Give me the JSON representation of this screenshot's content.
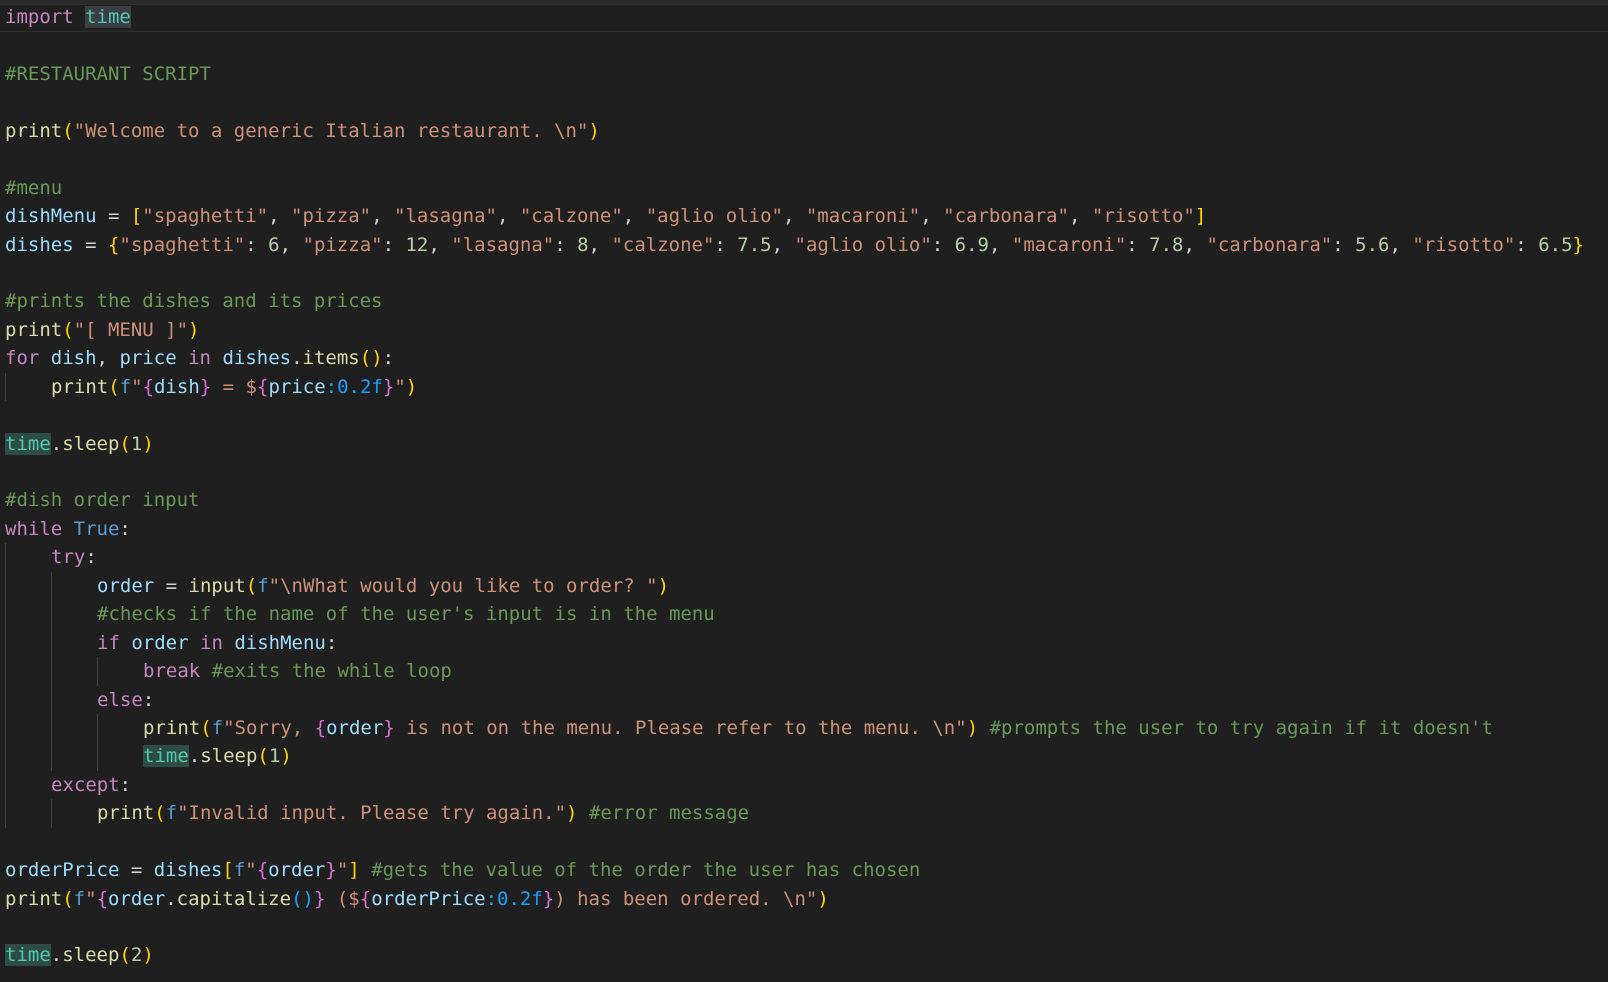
{
  "colors": {
    "background": "#1f1f1f",
    "keyword": "#c586c0",
    "function": "#dcdcaa",
    "variable": "#9cdcfe",
    "string": "#ce9178",
    "comment": "#6a9955",
    "number": "#b5cea8",
    "module": "#4ec9b0",
    "constant": "#569cd6",
    "plain": "#d4d4d4",
    "bracket1": "#ffd700",
    "bracket2": "#da70d6",
    "bracket3": "#179fff"
  },
  "lines": [
    {
      "indent": 0,
      "tokens": [
        {
          "t": "import",
          "k": "keyword"
        },
        {
          "t": " ",
          "k": "plain"
        },
        {
          "t": "time",
          "k": "module",
          "hl": true
        }
      ]
    },
    {
      "indent": 0,
      "tokens": []
    },
    {
      "indent": 0,
      "tokens": [
        {
          "t": "#RESTAURANT SCRIPT",
          "k": "comment"
        }
      ]
    },
    {
      "indent": 0,
      "tokens": []
    },
    {
      "indent": 0,
      "tokens": [
        {
          "t": "print",
          "k": "function"
        },
        {
          "t": "(",
          "k": "bracket1"
        },
        {
          "t": "\"Welcome to a generic Italian restaurant. \\n\"",
          "k": "string"
        },
        {
          "t": ")",
          "k": "bracket1"
        }
      ]
    },
    {
      "indent": 0,
      "tokens": []
    },
    {
      "indent": 0,
      "tokens": [
        {
          "t": "#menu",
          "k": "comment"
        }
      ]
    },
    {
      "indent": 0,
      "tokens": [
        {
          "t": "dishMenu",
          "k": "variable"
        },
        {
          "t": " = ",
          "k": "plain"
        },
        {
          "t": "[",
          "k": "bracket1"
        },
        {
          "t": "\"spaghetti\"",
          "k": "string"
        },
        {
          "t": ", ",
          "k": "plain"
        },
        {
          "t": "\"pizza\"",
          "k": "string"
        },
        {
          "t": ", ",
          "k": "plain"
        },
        {
          "t": "\"lasagna\"",
          "k": "string"
        },
        {
          "t": ", ",
          "k": "plain"
        },
        {
          "t": "\"calzone\"",
          "k": "string"
        },
        {
          "t": ", ",
          "k": "plain"
        },
        {
          "t": "\"aglio olio\"",
          "k": "string"
        },
        {
          "t": ", ",
          "k": "plain"
        },
        {
          "t": "\"macaroni\"",
          "k": "string"
        },
        {
          "t": ", ",
          "k": "plain"
        },
        {
          "t": "\"carbonara\"",
          "k": "string"
        },
        {
          "t": ", ",
          "k": "plain"
        },
        {
          "t": "\"risotto\"",
          "k": "string"
        },
        {
          "t": "]",
          "k": "bracket1"
        }
      ]
    },
    {
      "indent": 0,
      "tokens": [
        {
          "t": "dishes",
          "k": "variable"
        },
        {
          "t": " = ",
          "k": "plain"
        },
        {
          "t": "{",
          "k": "bracket1"
        },
        {
          "t": "\"spaghetti\"",
          "k": "string"
        },
        {
          "t": ": ",
          "k": "plain"
        },
        {
          "t": "6",
          "k": "number"
        },
        {
          "t": ", ",
          "k": "plain"
        },
        {
          "t": "\"pizza\"",
          "k": "string"
        },
        {
          "t": ": ",
          "k": "plain"
        },
        {
          "t": "12",
          "k": "number"
        },
        {
          "t": ", ",
          "k": "plain"
        },
        {
          "t": "\"lasagna\"",
          "k": "string"
        },
        {
          "t": ": ",
          "k": "plain"
        },
        {
          "t": "8",
          "k": "number"
        },
        {
          "t": ", ",
          "k": "plain"
        },
        {
          "t": "\"calzone\"",
          "k": "string"
        },
        {
          "t": ": ",
          "k": "plain"
        },
        {
          "t": "7.5",
          "k": "number"
        },
        {
          "t": ", ",
          "k": "plain"
        },
        {
          "t": "\"aglio olio\"",
          "k": "string"
        },
        {
          "t": ": ",
          "k": "plain"
        },
        {
          "t": "6.9",
          "k": "number"
        },
        {
          "t": ", ",
          "k": "plain"
        },
        {
          "t": "\"macaroni\"",
          "k": "string"
        },
        {
          "t": ": ",
          "k": "plain"
        },
        {
          "t": "7.8",
          "k": "number"
        },
        {
          "t": ", ",
          "k": "plain"
        },
        {
          "t": "\"carbonara\"",
          "k": "string"
        },
        {
          "t": ": ",
          "k": "plain"
        },
        {
          "t": "5.6",
          "k": "number"
        },
        {
          "t": ", ",
          "k": "plain"
        },
        {
          "t": "\"risotto\"",
          "k": "string"
        },
        {
          "t": ": ",
          "k": "plain"
        },
        {
          "t": "6.5",
          "k": "number"
        },
        {
          "t": "}",
          "k": "bracket1"
        }
      ]
    },
    {
      "indent": 0,
      "tokens": []
    },
    {
      "indent": 0,
      "tokens": [
        {
          "t": "#prints the dishes and its prices",
          "k": "comment"
        }
      ]
    },
    {
      "indent": 0,
      "tokens": [
        {
          "t": "print",
          "k": "function"
        },
        {
          "t": "(",
          "k": "bracket1"
        },
        {
          "t": "\"[ MENU ]\"",
          "k": "string"
        },
        {
          "t": ")",
          "k": "bracket1"
        }
      ]
    },
    {
      "indent": 0,
      "tokens": [
        {
          "t": "for",
          "k": "keyword"
        },
        {
          "t": " ",
          "k": "plain"
        },
        {
          "t": "dish",
          "k": "variable"
        },
        {
          "t": ", ",
          "k": "plain"
        },
        {
          "t": "price",
          "k": "variable"
        },
        {
          "t": " ",
          "k": "plain"
        },
        {
          "t": "in",
          "k": "keyword"
        },
        {
          "t": " ",
          "k": "plain"
        },
        {
          "t": "dishes",
          "k": "variable"
        },
        {
          "t": ".",
          "k": "plain"
        },
        {
          "t": "items",
          "k": "function"
        },
        {
          "t": "(",
          "k": "bracket1"
        },
        {
          "t": ")",
          "k": "bracket1"
        },
        {
          "t": ":",
          "k": "plain"
        }
      ]
    },
    {
      "indent": 1,
      "tokens": [
        {
          "t": "print",
          "k": "function"
        },
        {
          "t": "(",
          "k": "bracket1"
        },
        {
          "t": "f",
          "k": "constant"
        },
        {
          "t": "\"",
          "k": "string"
        },
        {
          "t": "{",
          "k": "bracket2"
        },
        {
          "t": "dish",
          "k": "variable"
        },
        {
          "t": "}",
          "k": "bracket2"
        },
        {
          "t": " = $",
          "k": "string"
        },
        {
          "t": "{",
          "k": "bracket2"
        },
        {
          "t": "price",
          "k": "variable"
        },
        {
          "t": ":0.2f",
          "k": "bracket3"
        },
        {
          "t": "}",
          "k": "bracket2"
        },
        {
          "t": "\"",
          "k": "string"
        },
        {
          "t": ")",
          "k": "bracket1"
        }
      ]
    },
    {
      "indent": 0,
      "tokens": []
    },
    {
      "indent": 0,
      "tokens": [
        {
          "t": "time",
          "k": "module",
          "hl2": true
        },
        {
          "t": ".",
          "k": "plain"
        },
        {
          "t": "sleep",
          "k": "function"
        },
        {
          "t": "(",
          "k": "bracket1"
        },
        {
          "t": "1",
          "k": "number"
        },
        {
          "t": ")",
          "k": "bracket1"
        }
      ]
    },
    {
      "indent": 0,
      "tokens": []
    },
    {
      "indent": 0,
      "tokens": [
        {
          "t": "#dish order input",
          "k": "comment"
        }
      ]
    },
    {
      "indent": 0,
      "tokens": [
        {
          "t": "while",
          "k": "keyword"
        },
        {
          "t": " ",
          "k": "plain"
        },
        {
          "t": "True",
          "k": "constant"
        },
        {
          "t": ":",
          "k": "plain"
        }
      ]
    },
    {
      "indent": 1,
      "tokens": [
        {
          "t": "try",
          "k": "keyword"
        },
        {
          "t": ":",
          "k": "plain"
        }
      ]
    },
    {
      "indent": 2,
      "tokens": [
        {
          "t": "order",
          "k": "variable"
        },
        {
          "t": " = ",
          "k": "plain"
        },
        {
          "t": "input",
          "k": "function"
        },
        {
          "t": "(",
          "k": "bracket1"
        },
        {
          "t": "f",
          "k": "constant"
        },
        {
          "t": "\"\\nWhat would you like to order? \"",
          "k": "string"
        },
        {
          "t": ")",
          "k": "bracket1"
        }
      ]
    },
    {
      "indent": 2,
      "tokens": [
        {
          "t": "#checks if the name of the user's input is in the menu",
          "k": "comment"
        }
      ]
    },
    {
      "indent": 2,
      "tokens": [
        {
          "t": "if",
          "k": "keyword"
        },
        {
          "t": " ",
          "k": "plain"
        },
        {
          "t": "order",
          "k": "variable"
        },
        {
          "t": " ",
          "k": "plain"
        },
        {
          "t": "in",
          "k": "keyword"
        },
        {
          "t": " ",
          "k": "plain"
        },
        {
          "t": "dishMenu",
          "k": "variable"
        },
        {
          "t": ":",
          "k": "plain"
        }
      ]
    },
    {
      "indent": 3,
      "tokens": [
        {
          "t": "break",
          "k": "keyword"
        },
        {
          "t": " ",
          "k": "plain"
        },
        {
          "t": "#exits the while loop",
          "k": "comment"
        }
      ]
    },
    {
      "indent": 2,
      "tokens": [
        {
          "t": "else",
          "k": "keyword"
        },
        {
          "t": ":",
          "k": "plain"
        }
      ]
    },
    {
      "indent": 3,
      "tokens": [
        {
          "t": "print",
          "k": "function"
        },
        {
          "t": "(",
          "k": "bracket1"
        },
        {
          "t": "f",
          "k": "constant"
        },
        {
          "t": "\"Sorry, ",
          "k": "string"
        },
        {
          "t": "{",
          "k": "bracket2"
        },
        {
          "t": "order",
          "k": "variable"
        },
        {
          "t": "}",
          "k": "bracket2"
        },
        {
          "t": " is not on the menu. Please refer to the menu. \\n\"",
          "k": "string"
        },
        {
          "t": ")",
          "k": "bracket1"
        },
        {
          "t": " ",
          "k": "plain"
        },
        {
          "t": "#prompts the user to try again if it doesn't",
          "k": "comment"
        }
      ]
    },
    {
      "indent": 3,
      "tokens": [
        {
          "t": "time",
          "k": "module",
          "hl2": true
        },
        {
          "t": ".",
          "k": "plain"
        },
        {
          "t": "sleep",
          "k": "function"
        },
        {
          "t": "(",
          "k": "bracket1"
        },
        {
          "t": "1",
          "k": "number"
        },
        {
          "t": ")",
          "k": "bracket1"
        }
      ]
    },
    {
      "indent": 1,
      "tokens": [
        {
          "t": "except",
          "k": "keyword"
        },
        {
          "t": ":",
          "k": "plain"
        }
      ]
    },
    {
      "indent": 2,
      "tokens": [
        {
          "t": "print",
          "k": "function"
        },
        {
          "t": "(",
          "k": "bracket1"
        },
        {
          "t": "f",
          "k": "constant"
        },
        {
          "t": "\"Invalid input. Please try again.\"",
          "k": "string"
        },
        {
          "t": ")",
          "k": "bracket1"
        },
        {
          "t": " ",
          "k": "plain"
        },
        {
          "t": "#error message",
          "k": "comment"
        }
      ]
    },
    {
      "indent": 0,
      "tokens": []
    },
    {
      "indent": 0,
      "tokens": [
        {
          "t": "orderPrice",
          "k": "variable"
        },
        {
          "t": " = ",
          "k": "plain"
        },
        {
          "t": "dishes",
          "k": "variable"
        },
        {
          "t": "[",
          "k": "bracket1"
        },
        {
          "t": "f",
          "k": "constant"
        },
        {
          "t": "\"",
          "k": "string"
        },
        {
          "t": "{",
          "k": "bracket2"
        },
        {
          "t": "order",
          "k": "variable"
        },
        {
          "t": "}",
          "k": "bracket2"
        },
        {
          "t": "\"",
          "k": "string"
        },
        {
          "t": "]",
          "k": "bracket1"
        },
        {
          "t": " ",
          "k": "plain"
        },
        {
          "t": "#gets the value of the order the user has chosen",
          "k": "comment"
        }
      ]
    },
    {
      "indent": 0,
      "tokens": [
        {
          "t": "print",
          "k": "function"
        },
        {
          "t": "(",
          "k": "bracket1"
        },
        {
          "t": "f",
          "k": "constant"
        },
        {
          "t": "\"",
          "k": "string"
        },
        {
          "t": "{",
          "k": "bracket2"
        },
        {
          "t": "order",
          "k": "variable"
        },
        {
          "t": ".",
          "k": "plain"
        },
        {
          "t": "capitalize",
          "k": "function"
        },
        {
          "t": "()",
          "k": "bracket3"
        },
        {
          "t": "}",
          "k": "bracket2"
        },
        {
          "t": " ($",
          "k": "string"
        },
        {
          "t": "{",
          "k": "bracket2"
        },
        {
          "t": "orderPrice",
          "k": "variable"
        },
        {
          "t": ":0.2f",
          "k": "bracket3"
        },
        {
          "t": "}",
          "k": "bracket2"
        },
        {
          "t": ") has been ordered. \\n\"",
          "k": "string"
        },
        {
          "t": ")",
          "k": "bracket1"
        }
      ]
    },
    {
      "indent": 0,
      "tokens": []
    },
    {
      "indent": 0,
      "tokens": [
        {
          "t": "time",
          "k": "module",
          "hl2": true
        },
        {
          "t": ".",
          "k": "plain"
        },
        {
          "t": "sleep",
          "k": "function"
        },
        {
          "t": "(",
          "k": "bracket1"
        },
        {
          "t": "2",
          "k": "number"
        },
        {
          "t": ")",
          "k": "bracket1"
        }
      ]
    }
  ]
}
